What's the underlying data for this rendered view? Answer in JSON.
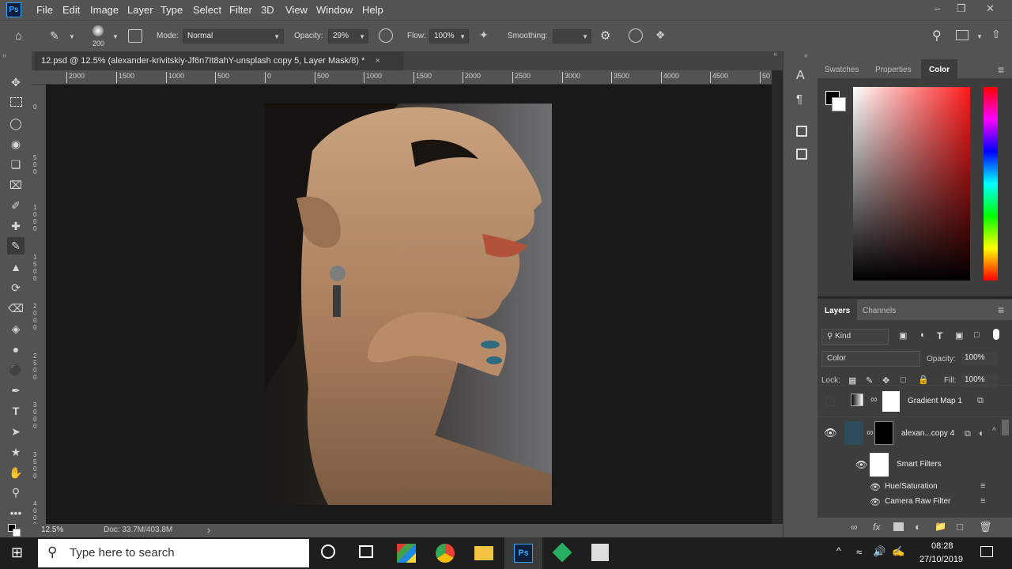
{
  "app": {
    "logo": "Ps"
  },
  "menu": [
    "File",
    "Edit",
    "Image",
    "Layer",
    "Type",
    "Select",
    "Filter",
    "3D",
    "View",
    "Window",
    "Help"
  ],
  "options": {
    "brush_size": "200",
    "mode_label": "Mode:",
    "mode_value": "Normal",
    "opacity_label": "Opacity:",
    "opacity_value": "29%",
    "flow_label": "Flow:",
    "flow_value": "100%",
    "smoothing_label": "Smoothing:",
    "smoothing_value": ""
  },
  "document": {
    "tab_title": "12.psd @ 12.5% (alexander-krivitskiy-Jf6n7It8ahY-unsplash copy 5, Layer Mask/8) *",
    "close": "×"
  },
  "ruler": {
    "h_ticks": [
      "2000",
      "1500",
      "1000",
      "500",
      "0",
      "500",
      "1000",
      "1500",
      "2000",
      "2500",
      "3000",
      "3500",
      "4000",
      "4500",
      "50"
    ],
    "v_ticks": [
      "0",
      "500",
      "1000",
      "1500",
      "2000",
      "2500",
      "3000",
      "3500",
      "4000"
    ]
  },
  "status": {
    "zoom": "12.5%",
    "doc": "Doc: 33.7M/403.8M",
    "arrow": "›"
  },
  "color_panel": {
    "tabs": [
      "Swatches",
      "Properties",
      "Color"
    ],
    "active_tab": "Color",
    "foreground": "#000000",
    "background": "#ffffff",
    "hue_color": "#ff1a1a"
  },
  "layers_panel": {
    "tabs": [
      "Layers",
      "Channels"
    ],
    "filter_label": "Kind",
    "blend_mode": "Color",
    "opacity_label": "Opacity:",
    "opacity_value": "100%",
    "lock_label": "Lock:",
    "fill_label": "Fill:",
    "fill_value": "100%",
    "layers": [
      {
        "name": "Gradient Map 1"
      },
      {
        "name": "alexan...copy 4"
      },
      {
        "name": "Smart Filters"
      },
      {
        "name": "Hue/Saturation"
      },
      {
        "name": "Camera Raw Filter"
      }
    ],
    "footer_icons": [
      "link-icon",
      "fx-icon",
      "mask-icon",
      "adjustment-icon",
      "folder-icon",
      "new-layer-icon",
      "trash-icon"
    ]
  },
  "taskbar": {
    "search_placeholder": "Type here to search",
    "time": "08:28",
    "date": "27/10/2019"
  }
}
